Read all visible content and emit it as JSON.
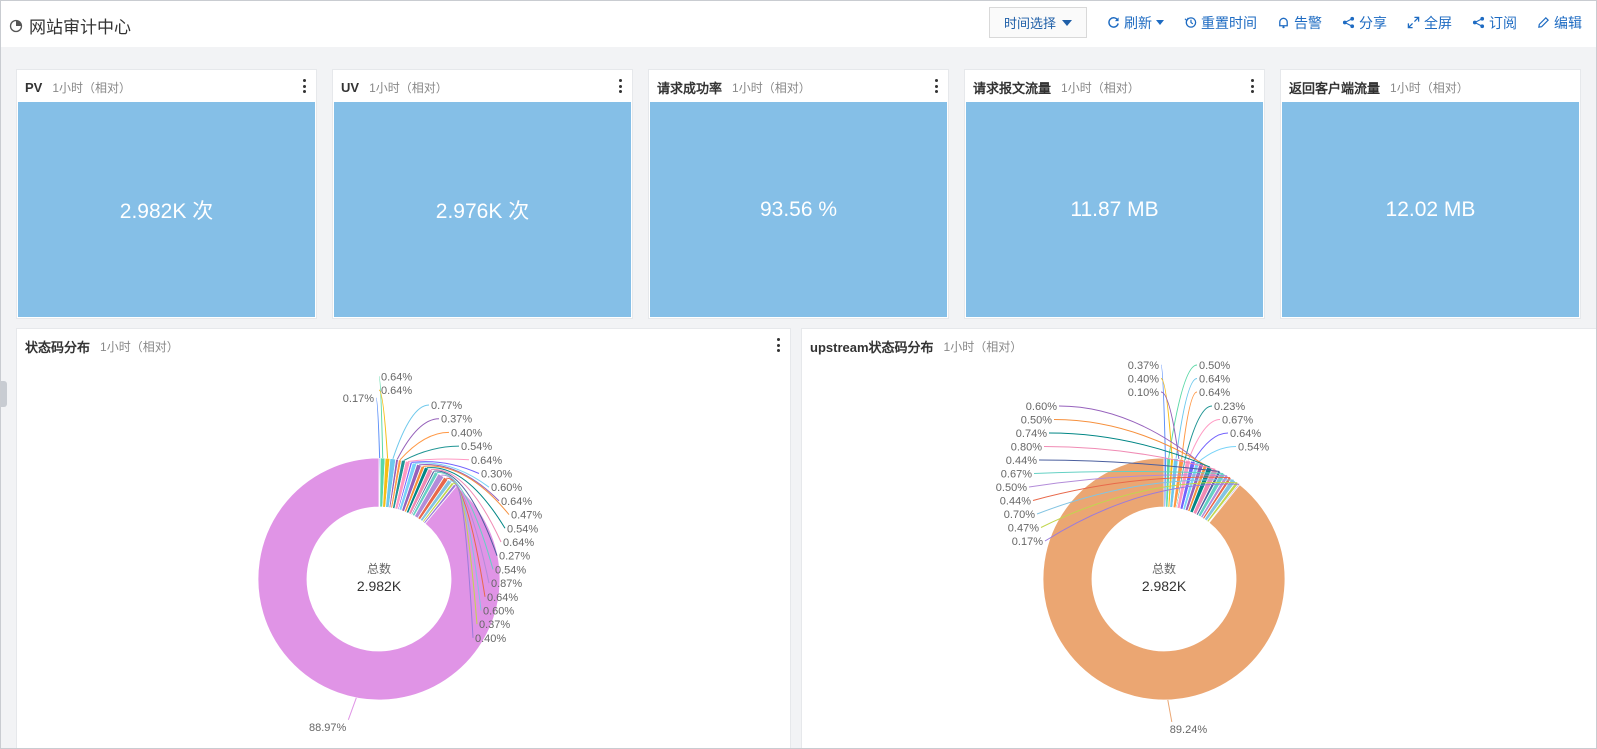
{
  "header": {
    "title": "网站审计中心",
    "time_select": "时间选择",
    "refresh": "刷新",
    "reset_time": "重置时间",
    "alert": "告警",
    "share": "分享",
    "fullscreen": "全屏",
    "subscribe": "订阅",
    "edit": "编辑"
  },
  "stats": [
    {
      "title": "PV",
      "sub": "1小时（相对）",
      "value": "2.982K 次"
    },
    {
      "title": "UV",
      "sub": "1小时（相对）",
      "value": "2.976K 次"
    },
    {
      "title": "请求成功率",
      "sub": "1小时（相对）",
      "value": "93.56 %"
    },
    {
      "title": "请求报文流量",
      "sub": "1小时（相对）",
      "value": "11.87 MB"
    },
    {
      "title": "返回客户端流量",
      "sub": "1小时（相对）",
      "value": "12.02 MB"
    }
  ],
  "charts": {
    "status": {
      "title": "状态码分布",
      "sub": "1小时（相对）",
      "center_label": "总数",
      "center_value": "2.982K"
    },
    "upstream": {
      "title": "upstream状态码分布",
      "sub": "1小时（相对）",
      "center_label": "总数",
      "center_value": "2.982K"
    }
  },
  "colors": {
    "stat_bg": "#85bfe7",
    "status_main": "#e094e6",
    "upstream_main": "#eba672",
    "link": "#1e6bc2"
  },
  "chart_data": [
    {
      "type": "pie",
      "title": "状态码分布",
      "values": [
        88.97,
        0.17,
        0.64,
        0.64,
        0.77,
        0.37,
        0.4,
        0.54,
        0.64,
        0.3,
        0.6,
        0.64,
        0.47,
        0.54,
        0.64,
        0.27,
        0.54,
        0.87,
        0.64,
        0.6,
        0.37,
        0.4
      ],
      "labels": [
        "88.97%",
        "0.17%",
        "0.64%",
        "0.64%",
        "0.77%",
        "0.37%",
        "0.40%",
        "0.54%",
        "0.64%",
        "0.30%",
        "0.60%",
        "0.64%",
        "0.47%",
        "0.54%",
        "0.64%",
        "0.27%",
        "0.54%",
        "0.87%",
        "0.64%",
        "0.60%",
        "0.37%",
        "0.40%"
      ],
      "center": "总数 2.982K"
    },
    {
      "type": "pie",
      "title": "upstream状态码分布",
      "values": [
        89.24,
        0.37,
        0.5,
        0.4,
        0.64,
        0.1,
        0.64,
        0.23,
        0.67,
        0.64,
        0.54,
        0.6,
        0.5,
        0.74,
        0.8,
        0.44,
        0.67,
        0.5,
        0.44,
        0.7,
        0.47,
        0.17
      ],
      "labels": [
        "89.24%",
        "0.37%",
        "0.50%",
        "0.40%",
        "0.64%",
        "0.10%",
        "0.64%",
        "0.23%",
        "0.67%",
        "0.64%",
        "0.54%",
        "0.60%",
        "0.50%",
        "0.74%",
        "0.80%",
        "0.44%",
        "0.67%",
        "0.50%",
        "0.44%",
        "0.70%",
        "0.47%",
        "0.17%"
      ],
      "center": "总数 2.982K"
    }
  ]
}
